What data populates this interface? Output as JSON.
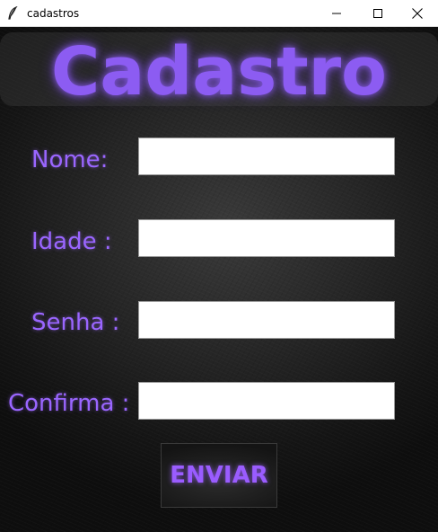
{
  "window": {
    "title": "cadastros",
    "icon": "feather-icon",
    "controls": [
      "minimize-icon",
      "maximize-icon",
      "close-icon"
    ]
  },
  "form": {
    "heading": "Cadastro",
    "fields": [
      {
        "label": "Nome:",
        "value": ""
      },
      {
        "label": "Idade :",
        "value": ""
      },
      {
        "label": "Senha :",
        "value": ""
      },
      {
        "label": "Confirma :",
        "value": ""
      }
    ],
    "submit_label": "ENVIAR"
  },
  "colors": {
    "accent": "#9a66ff",
    "background": "#1e1e1e",
    "input_bg": "#ffffff"
  }
}
